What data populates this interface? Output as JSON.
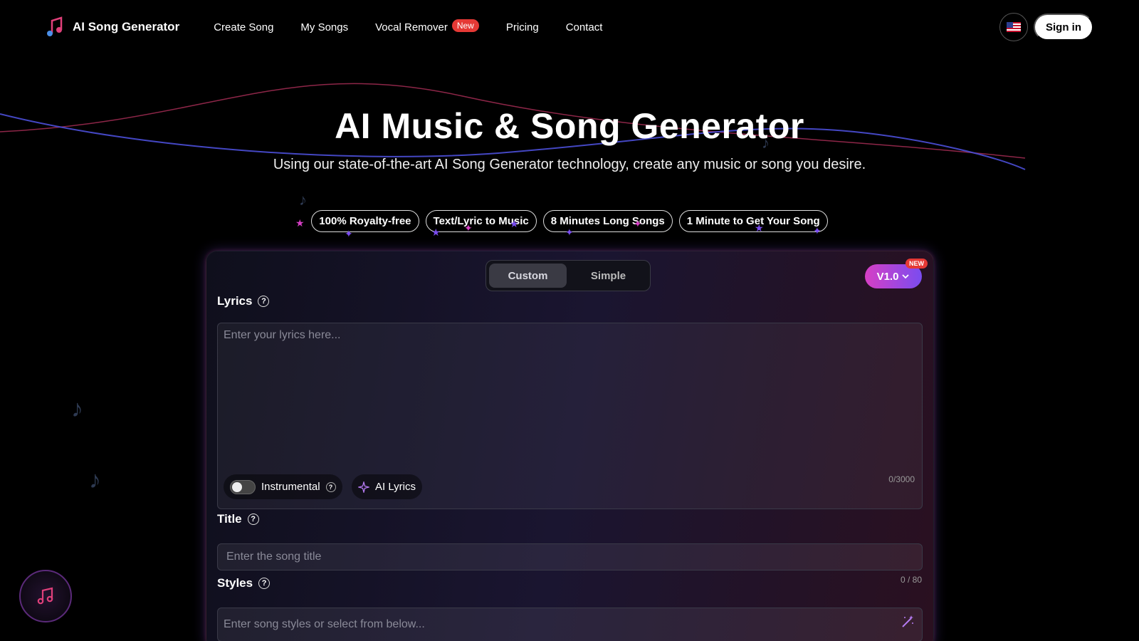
{
  "brand": {
    "name": "AI Song Generator",
    "logo_icon": "music-note-logo-icon"
  },
  "nav": {
    "items": [
      {
        "label": "Create Song"
      },
      {
        "label": "My Songs"
      },
      {
        "label": "Vocal Remover",
        "badge": "New"
      },
      {
        "label": "Pricing"
      },
      {
        "label": "Contact"
      }
    ]
  },
  "header": {
    "language_icon": "us-flag-icon",
    "signin_label": "Sign in"
  },
  "hero": {
    "title": "AI Music & Song Generator",
    "subtitle": "Using our state-of-the-art AI Song Generator technology, create any music or song you desire.",
    "features": [
      "100% Royalty-free",
      "Text/Lyric to Music",
      "8 Minutes Long Songs",
      "1 Minute to Get Your Song"
    ]
  },
  "form": {
    "tabs": [
      {
        "label": "Custom",
        "active": true
      },
      {
        "label": "Simple",
        "active": false
      }
    ],
    "version": {
      "label": "V1.0",
      "badge": "NEW"
    },
    "lyrics": {
      "label": "Lyrics",
      "placeholder": "Enter your lyrics here...",
      "counter": "0/3000"
    },
    "instrumental_label": "Instrumental",
    "ai_lyrics_label": "AI Lyrics",
    "title": {
      "label": "Title",
      "placeholder": "Enter the song title",
      "counter": "0 / 80"
    },
    "styles": {
      "label": "Styles",
      "placeholder": "Enter song styles or select from below..."
    }
  },
  "colors": {
    "accent_pink": "#d63fc5",
    "accent_purple": "#7a4cf0",
    "badge_red": "#e53935"
  }
}
